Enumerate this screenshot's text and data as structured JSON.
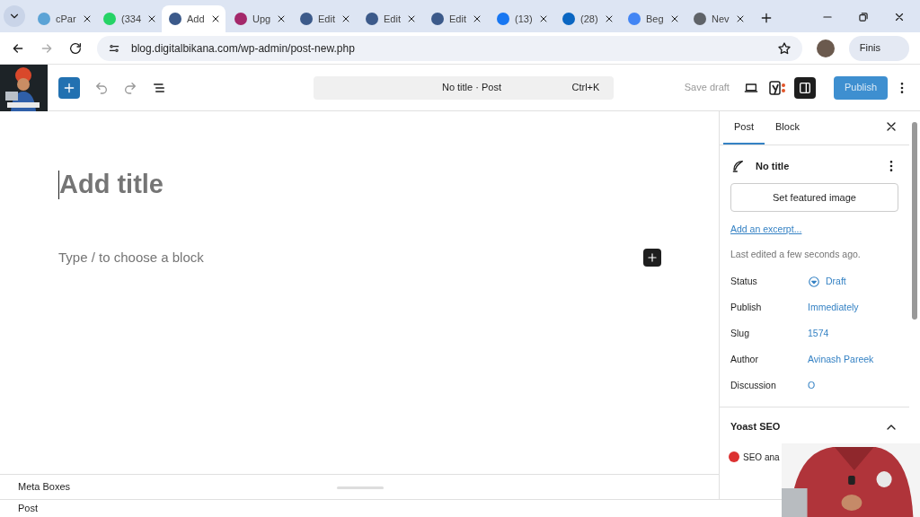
{
  "browser": {
    "tabs": [
      {
        "label": "cPar",
        "color": "#5ba3d6",
        "selected": false
      },
      {
        "label": "(334",
        "color": "#25d366",
        "selected": false
      },
      {
        "label": "Add",
        "color": "#3c5a8a",
        "selected": true
      },
      {
        "label": "Upg",
        "color": "#a4286a",
        "selected": false
      },
      {
        "label": "Edit",
        "color": "#3c5a8a",
        "selected": false
      },
      {
        "label": "Edit",
        "color": "#3c5a8a",
        "selected": false
      },
      {
        "label": "Edit",
        "color": "#3c5a8a",
        "selected": false
      },
      {
        "label": "(13)",
        "color": "#1877f2",
        "selected": false
      },
      {
        "label": "(28)",
        "color": "#0a66c2",
        "selected": false
      },
      {
        "label": "Beg",
        "color": "#4285f4",
        "selected": false
      },
      {
        "label": "Nev",
        "color": "#5f6368",
        "selected": false
      }
    ],
    "address": "blog.digitalbikana.com/wp-admin/post-new.php",
    "update_button": "Finis"
  },
  "toolbar": {
    "command_bar": {
      "label": "No title · Post",
      "shortcut": "Ctrl+K"
    },
    "save_draft": "Save draft",
    "settings_open": true,
    "publish": "Publish"
  },
  "editor": {
    "title_placeholder": "Add title",
    "block_placeholder": "Type / to choose a block"
  },
  "sidebar": {
    "tabs": [
      {
        "label": "Post",
        "selected": true
      },
      {
        "label": "Block",
        "selected": false
      }
    ],
    "post_title": "No title",
    "featured_image_button": "Set featured image",
    "excerpt_link": "Add an excerpt...",
    "last_edited": "Last edited a few seconds ago.",
    "fields": [
      {
        "label": "Status",
        "value": "Draft",
        "kind": "status"
      },
      {
        "label": "Publish",
        "value": "Immediately",
        "kind": "link"
      },
      {
        "label": "Slug",
        "value": "1574",
        "kind": "link"
      },
      {
        "label": "Author",
        "value": "Avinash Pareek",
        "kind": "link"
      },
      {
        "label": "Discussion",
        "value": "O",
        "kind": "link"
      }
    ],
    "yoast": {
      "title": "Yoast SEO",
      "expanded": true,
      "items": [
        {
          "label": "SEO ana",
          "color": "#dc3232"
        }
      ]
    }
  },
  "meta_boxes": "Meta Boxes",
  "breadcrumb": "Post"
}
